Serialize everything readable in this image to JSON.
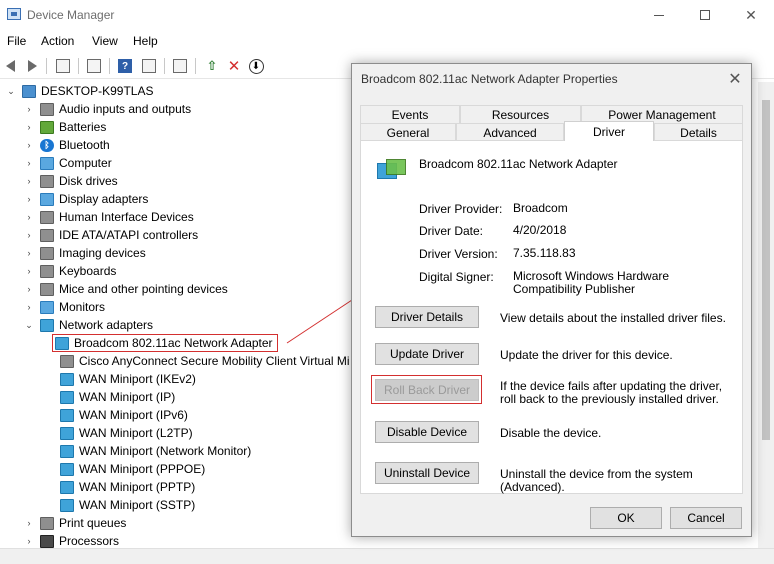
{
  "window": {
    "title": "Device Manager"
  },
  "menu": [
    "File",
    "Action",
    "View",
    "Help"
  ],
  "tree": {
    "root": "DESKTOP-K99TLAS",
    "categories": [
      "Audio inputs and outputs",
      "Batteries",
      "Bluetooth",
      "Computer",
      "Disk drives",
      "Display adapters",
      "Human Interface Devices",
      "IDE ATA/ATAPI controllers",
      "Imaging devices",
      "Keyboards",
      "Mice and other pointing devices",
      "Monitors",
      "Network adapters"
    ],
    "network_children": [
      "Broadcom 802.11ac Network Adapter",
      "Cisco AnyConnect Secure Mobility Client Virtual Mi",
      "WAN Miniport (IKEv2)",
      "WAN Miniport (IP)",
      "WAN Miniport (IPv6)",
      "WAN Miniport (L2TP)",
      "WAN Miniport (Network Monitor)",
      "WAN Miniport (PPPOE)",
      "WAN Miniport (PPTP)",
      "WAN Miniport (SSTP)"
    ],
    "after": [
      "Print queues",
      "Processors"
    ]
  },
  "dialog": {
    "title": "Broadcom 802.11ac Network Adapter Properties",
    "tabs_back": [
      "Events",
      "Resources",
      "Power Management"
    ],
    "tabs_front": [
      "General",
      "Advanced",
      "Driver",
      "Details"
    ],
    "device_name": "Broadcom 802.11ac Network Adapter",
    "info": [
      {
        "label": "Driver Provider:",
        "value": "Broadcom"
      },
      {
        "label": "Driver Date:",
        "value": "4/20/2018"
      },
      {
        "label": "Driver Version:",
        "value": "7.35.118.83"
      },
      {
        "label": "Digital Signer:",
        "value": "Microsoft Windows Hardware Compatibility Publisher"
      }
    ],
    "buttons": [
      {
        "label": "Driver Details",
        "desc": "View details about the installed driver files."
      },
      {
        "label": "Update Driver",
        "desc": "Update the driver for this device."
      },
      {
        "label": "Roll Back Driver",
        "desc": "If the device fails after updating the driver, roll back to the previously installed driver."
      },
      {
        "label": "Disable Device",
        "desc": "Disable the device."
      },
      {
        "label": "Uninstall Device",
        "desc": "Uninstall the device from the system (Advanced)."
      }
    ],
    "ok": "OK",
    "cancel": "Cancel"
  },
  "colors": {
    "highlight": "#d32f2f",
    "tab_active": "#ffffff",
    "dialog_bg": "#f0f0f0"
  }
}
